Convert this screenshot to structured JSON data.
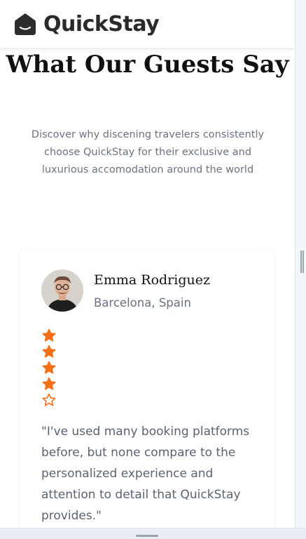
{
  "brand": {
    "name": "QuickStay",
    "logo_icon": "house-smile-icon"
  },
  "testimonials_section": {
    "heading": "What Our Guests Say",
    "subtitle": "Discover why discening travelers consistently choose QuickStay for their exclusive and luxurious accomodation around the world"
  },
  "testimonial": {
    "name": "Emma Rodriguez",
    "location": "Barcelona, Spain",
    "rating": 4,
    "rating_max": 5,
    "quote": "\"I've used many booking platforms before, but none compare to the personalized experience and attention to detail that QuickStay provides.\""
  },
  "colors": {
    "star": "#f46f16",
    "text_muted": "#6b7280"
  }
}
